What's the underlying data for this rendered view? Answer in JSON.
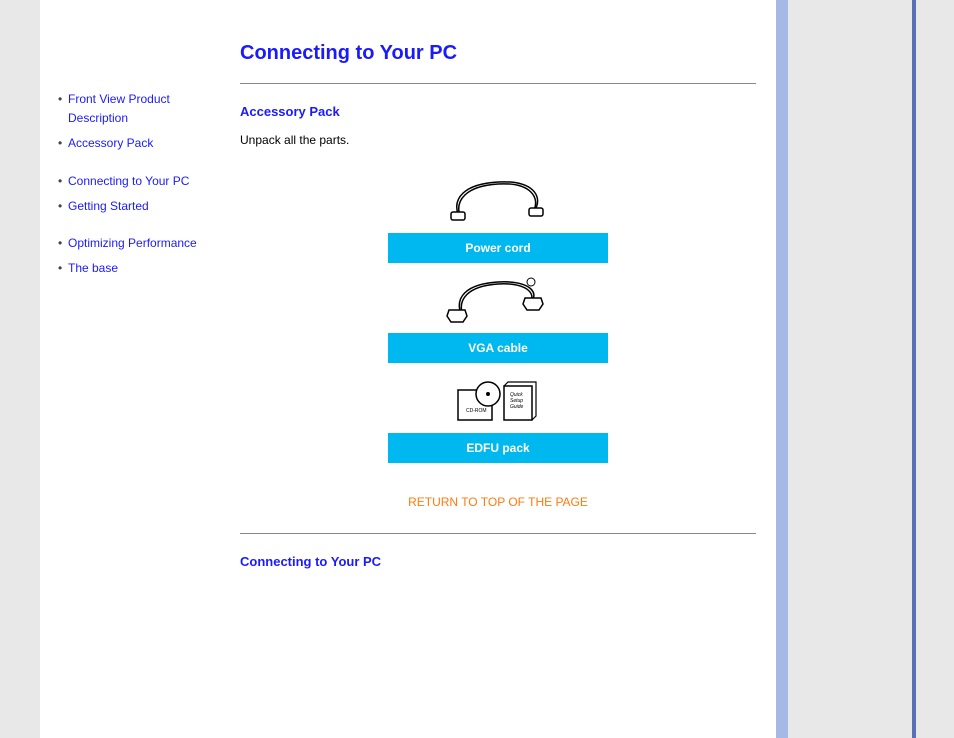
{
  "sidebar": {
    "items": [
      {
        "label": "Front View Product Description"
      },
      {
        "label": "Accessory Pack"
      },
      {
        "label": "Connecting to Your PC"
      },
      {
        "label": "Getting Started"
      },
      {
        "label": "Optimizing Performance"
      },
      {
        "label": "The base"
      }
    ]
  },
  "main": {
    "title": "Connecting to Your PC",
    "section1_heading": "Accessory Pack",
    "section1_text": "Unpack all the parts.",
    "accessories": [
      {
        "label": "Power cord"
      },
      {
        "label": "VGA cable"
      },
      {
        "label": "EDFU pack"
      }
    ],
    "return_link": "RETURN TO TOP OF THE PAGE",
    "section2_heading": "Connecting to Your PC"
  }
}
